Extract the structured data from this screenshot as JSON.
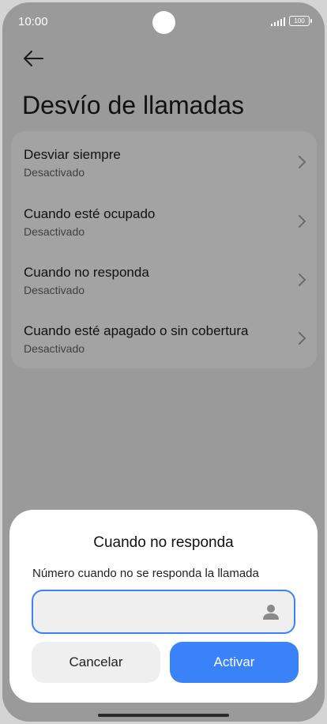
{
  "status_bar": {
    "time": "10:00",
    "battery": "100"
  },
  "header": {
    "title": "Desvío de llamadas"
  },
  "settings": {
    "items": [
      {
        "title": "Desviar siempre",
        "status": "Desactivado"
      },
      {
        "title": "Cuando esté ocupado",
        "status": "Desactivado"
      },
      {
        "title": "Cuando no responda",
        "status": "Desactivado"
      },
      {
        "title": "Cuando esté apagado o sin cobertura",
        "status": "Desactivado"
      }
    ]
  },
  "dialog": {
    "title": "Cuando no responda",
    "field_label": "Número cuando no se responda la llamada",
    "field_value": "",
    "cancel_label": "Cancelar",
    "confirm_label": "Activar"
  },
  "colors": {
    "accent": "#3a82f7",
    "overlay": "#9a9a9a"
  }
}
